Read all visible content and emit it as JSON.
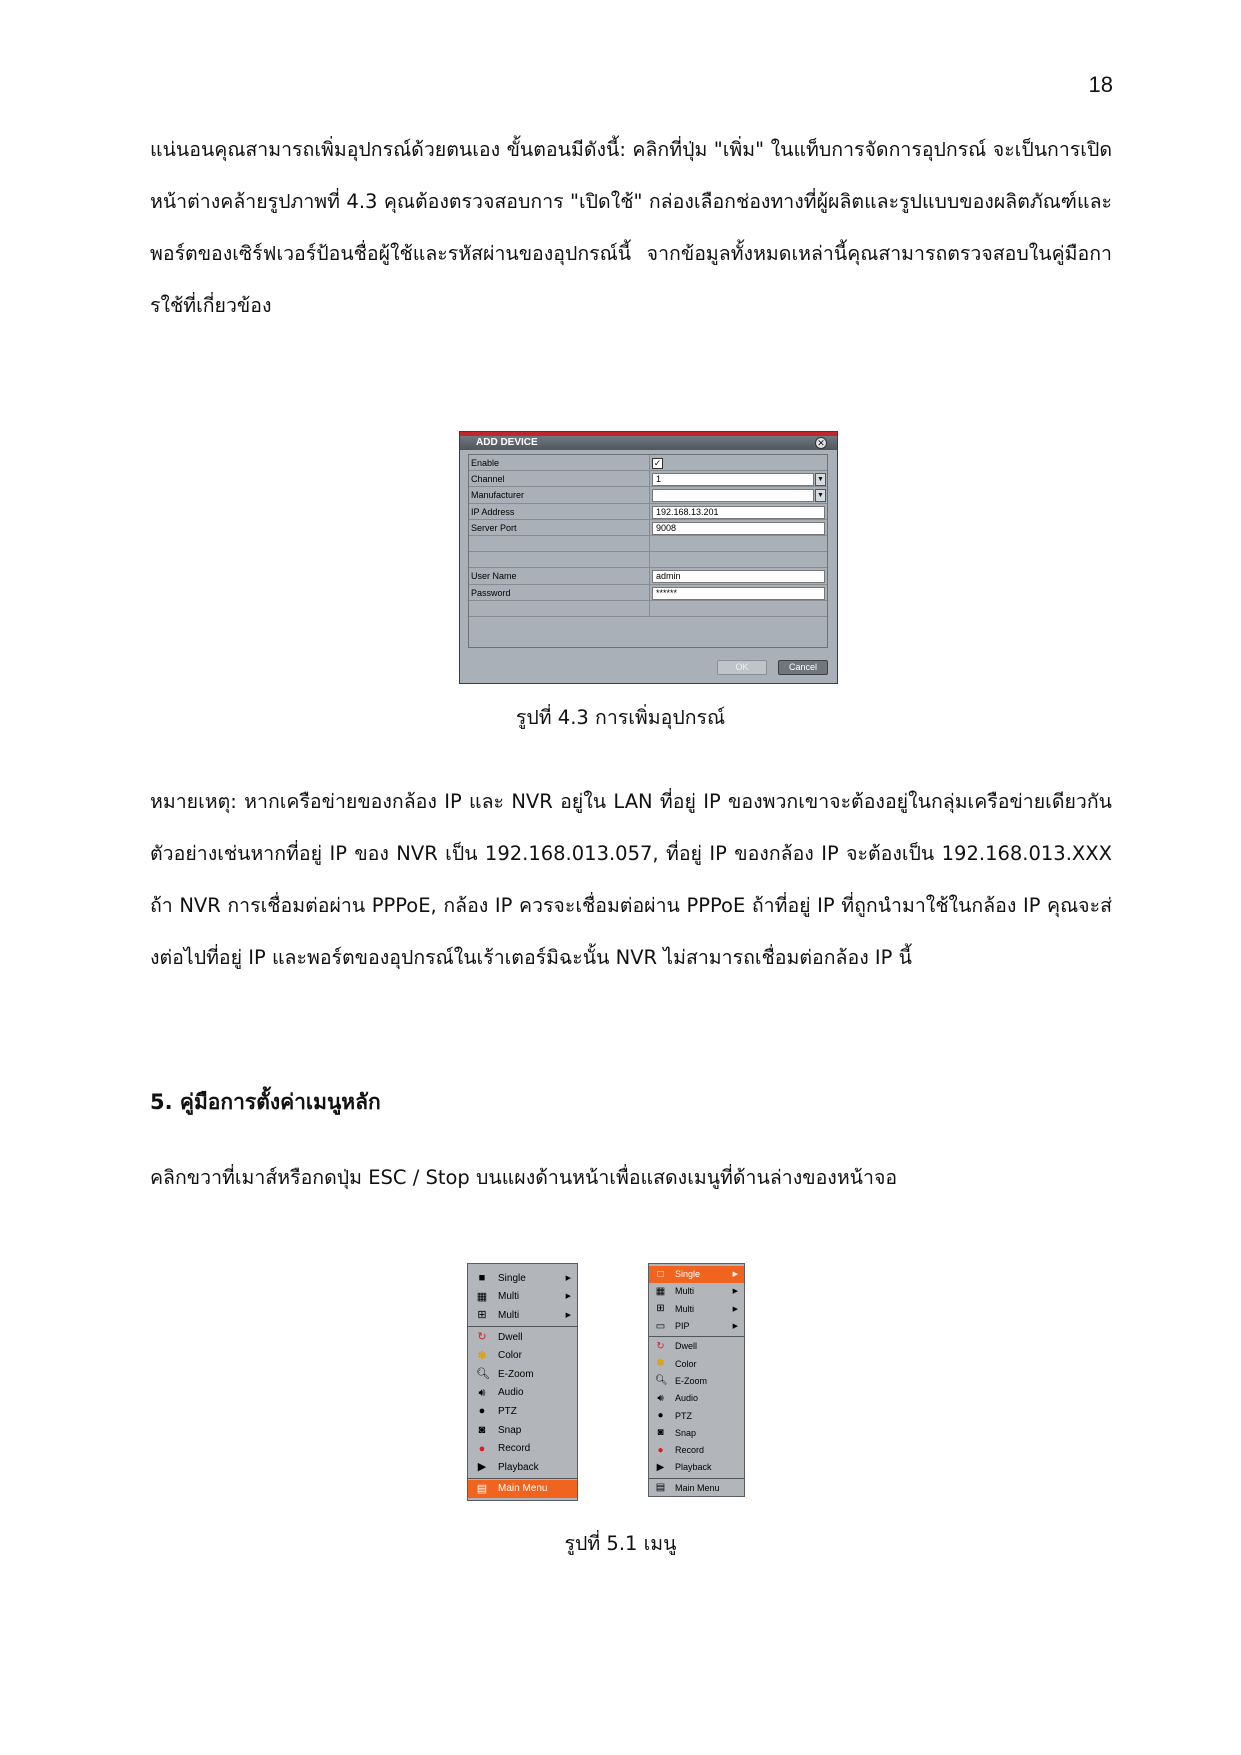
{
  "page_number": "18",
  "paragraph1": "แน่นอนคุณสามารถเพิ่มอุปกรณ์ด้วยตนเอง ขั้นตอนมีดังนี้: คลิกที่ปุ่ม \"เพิ่ม\" ในแท็บการจัดการอุปกรณ์ จะเป็นการเปิดหน้าต่างคล้ายรูปภาพที่ 4.3 คุณต้องตรวจสอบการ \"เปิดใช้\" กล่องเลือกช่องทางที่ผู้ผลิตและรูปแบบของผลิตภัณฑ์และพอร์ตของเซิร์ฟเวอร์ป้อนชื่อผู้ใช้และรหัสผ่านของอุปกรณ์นี้ จากข้อมูลทั้งหมดเหล่านี้คุณสามารถตรวจสอบในคู่มือการใช้ที่เกี่ยวข้อง",
  "figure1": {
    "title": "ADD DEVICE",
    "close_symbol": "✕",
    "check_symbol": "✓",
    "dropdown_symbol": "▼",
    "rows": [
      {
        "label": "Enable",
        "value": "",
        "type": "checkbox"
      },
      {
        "label": "Channel",
        "value": "1",
        "type": "select"
      },
      {
        "label": "Manufacturer",
        "value": "",
        "type": "select"
      },
      {
        "label": "IP Address",
        "value": "192.168.13.201",
        "type": "text"
      },
      {
        "label": "Server Port",
        "value": "9008",
        "type": "text"
      },
      {
        "label": "",
        "value": "",
        "type": "empty"
      },
      {
        "label": "",
        "value": "",
        "type": "empty"
      },
      {
        "label": "User Name",
        "value": "admin",
        "type": "text"
      },
      {
        "label": "Password",
        "value": "******",
        "type": "text"
      },
      {
        "label": "",
        "value": "",
        "type": "empty"
      }
    ],
    "ok_label": "OK",
    "cancel_label": "Cancel",
    "caption": "รูปที่ 4.3 การเพิ่มอุปกรณ์"
  },
  "paragraph2": "หมายเหตุ: หากเครือข่ายของกล้อง IP และ NVR อยู่ใน LAN ที่อยู่ IP ของพวกเขาจะต้องอยู่ในกลุ่มเครือข่ายเดียวกัน ตัวอย่างเช่นหากที่อยู่ IP ของ NVR เป็น 192.168.013.057, ที่อยู่ IP ของกล้อง IP จะต้องเป็น 192.168.013.XXX ถ้า NVR การเชื่อมต่อผ่าน PPPoE, กล้อง IP ควรจะเชื่อมต่อผ่าน PPPoE ถ้าที่อยู่ IP ที่ถูกนำมาใช้ในกล้อง IP คุณจะส่งต่อไปที่อยู่ IP และพอร์ตของอุปกรณ์ในเร้าเตอร์มิฉะนั้น NVR ไม่สามารถเชื่อมต่อกล้อง IP นี้",
  "section_heading": "5. คู่มือการตั้งค่าเมนูหลัก",
  "paragraph3": "คลิกขวาที่เมาส์หรือกดปุ่ม ESC / Stop บนแผงด้านหน้าเพื่อแสดงเมนูที่ด้านล่างของหน้าจอ",
  "figure2": {
    "caption": "รูปที่ 5.1 เมนู",
    "arrow_symbol": "▶",
    "menu_left": [
      {
        "label": "Single",
        "icon": "single-view-icon",
        "glyph": "■",
        "color": "#000000",
        "submenu": true,
        "highlight": false
      },
      {
        "label": "Multi",
        "icon": "grid-9-icon",
        "glyph": "▦",
        "color": "#000000",
        "submenu": true,
        "highlight": false
      },
      {
        "label": "Multi",
        "icon": "grid-4-icon",
        "glyph": "⊞",
        "color": "#000000",
        "submenu": true,
        "highlight": false,
        "separator_after": true
      },
      {
        "label": "Dwell",
        "icon": "dwell-icon",
        "glyph": "↻",
        "color": "#d8202a",
        "submenu": false,
        "highlight": false
      },
      {
        "label": "Color",
        "icon": "color-icon",
        "glyph": "✽",
        "color": "#e0a000",
        "submenu": false,
        "highlight": false
      },
      {
        "label": "E-Zoom",
        "icon": "zoom-icon",
        "glyph": "🔍︎",
        "color": "#000000",
        "submenu": false,
        "highlight": false
      },
      {
        "label": "Audio",
        "icon": "audio-icon",
        "glyph": "🔊︎",
        "color": "#000000",
        "submenu": false,
        "highlight": false
      },
      {
        "label": "PTZ",
        "icon": "ptz-icon",
        "glyph": "●",
        "color": "#000000",
        "submenu": false,
        "highlight": false
      },
      {
        "label": "Snap",
        "icon": "camera-icon",
        "glyph": "◙",
        "color": "#000000",
        "submenu": false,
        "highlight": false
      },
      {
        "label": "Record",
        "icon": "record-icon",
        "glyph": "●",
        "color": "#e01a1a",
        "submenu": false,
        "highlight": false
      },
      {
        "label": "Playback",
        "icon": "play-icon",
        "glyph": "▶",
        "color": "#000000",
        "submenu": false,
        "highlight": false,
        "separator_after": true
      },
      {
        "label": "Main Menu",
        "icon": "main-menu-icon",
        "glyph": "▤",
        "color": "#ffffff",
        "submenu": false,
        "highlight": true
      }
    ],
    "menu_right": [
      {
        "label": "Single",
        "icon": "single-view-icon",
        "glyph": "□",
        "color": "#ffffff",
        "submenu": true,
        "highlight": true
      },
      {
        "label": "Multi",
        "icon": "grid-9-icon",
        "glyph": "▦",
        "color": "#000000",
        "submenu": true,
        "highlight": false
      },
      {
        "label": "Multi",
        "icon": "grid-4-icon",
        "glyph": "⊞",
        "color": "#000000",
        "submenu": true,
        "highlight": false
      },
      {
        "label": "PIP",
        "icon": "pip-icon",
        "glyph": "▭",
        "color": "#000000",
        "submenu": true,
        "highlight": false,
        "separator_after": true
      },
      {
        "label": "Dwell",
        "icon": "dwell-icon",
        "glyph": "↻",
        "color": "#d8202a",
        "submenu": false,
        "highlight": false
      },
      {
        "label": "Color",
        "icon": "color-icon",
        "glyph": "✽",
        "color": "#e0a000",
        "submenu": false,
        "highlight": false
      },
      {
        "label": "E-Zoom",
        "icon": "zoom-icon",
        "glyph": "🔍︎",
        "color": "#000000",
        "submenu": false,
        "highlight": false
      },
      {
        "label": "Audio",
        "icon": "audio-icon",
        "glyph": "🔊︎",
        "color": "#000000",
        "submenu": false,
        "highlight": false
      },
      {
        "label": "PTZ",
        "icon": "ptz-icon",
        "glyph": "●",
        "color": "#000000",
        "submenu": false,
        "highlight": false
      },
      {
        "label": "Snap",
        "icon": "camera-icon",
        "glyph": "◙",
        "color": "#000000",
        "submenu": false,
        "highlight": false
      },
      {
        "label": "Record",
        "icon": "record-icon",
        "glyph": "●",
        "color": "#e01a1a",
        "submenu": false,
        "highlight": false
      },
      {
        "label": "Playback",
        "icon": "play-icon",
        "glyph": "▶",
        "color": "#000000",
        "submenu": false,
        "highlight": false,
        "separator_after": true
      },
      {
        "label": "Main Menu",
        "icon": "main-menu-icon",
        "glyph": "▤",
        "color": "#000000",
        "submenu": false,
        "highlight": false
      }
    ]
  }
}
